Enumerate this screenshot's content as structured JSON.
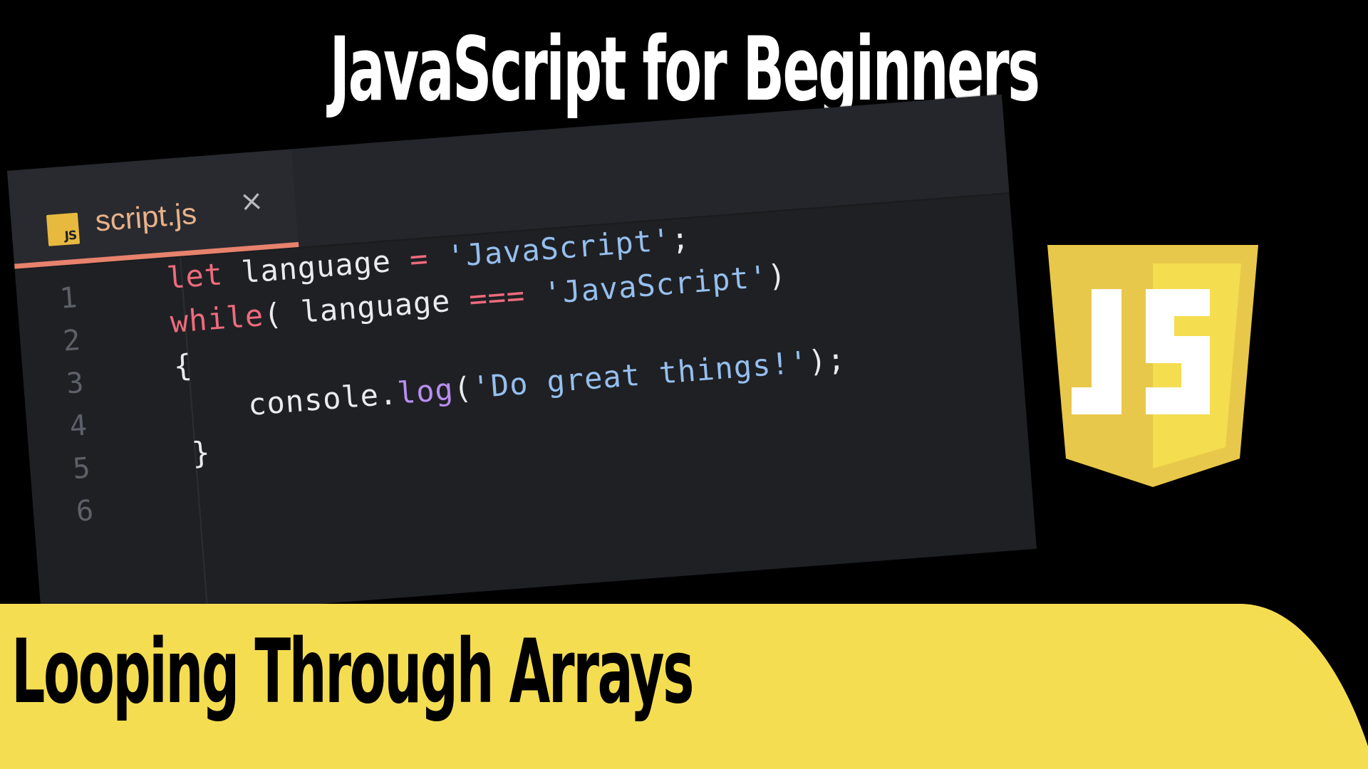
{
  "title": "JavaScript for Beginners",
  "subtitle": "Looping Through Arrays",
  "editor": {
    "tab_icon_label": "JS",
    "tab_label": "script.js",
    "close_glyph": "×",
    "line_numbers": [
      "1",
      "2",
      "3",
      "4",
      "5",
      "6"
    ],
    "code": {
      "line1": {
        "kw": "let",
        "ident": " language ",
        "op": "=",
        "str": " 'JavaScript'",
        "end": ";"
      },
      "line2": {
        "kw": "while",
        "open": "( language ",
        "op": "===",
        "str": " 'JavaScript'",
        "close": ")"
      },
      "line3": {
        "brace": "{"
      },
      "line4": {
        "obj": "console.",
        "fn": "log",
        "open": "(",
        "str": "'Do great things!'",
        "close": ");"
      },
      "line5": {
        "brace": "}"
      }
    }
  },
  "logo": {
    "text": "JS",
    "color_outer": "#e8c84a",
    "color_inner": "#f4dd4f"
  },
  "colors": {
    "background": "#000000",
    "banner": "#f5dd52",
    "accent": "#e7826c"
  }
}
